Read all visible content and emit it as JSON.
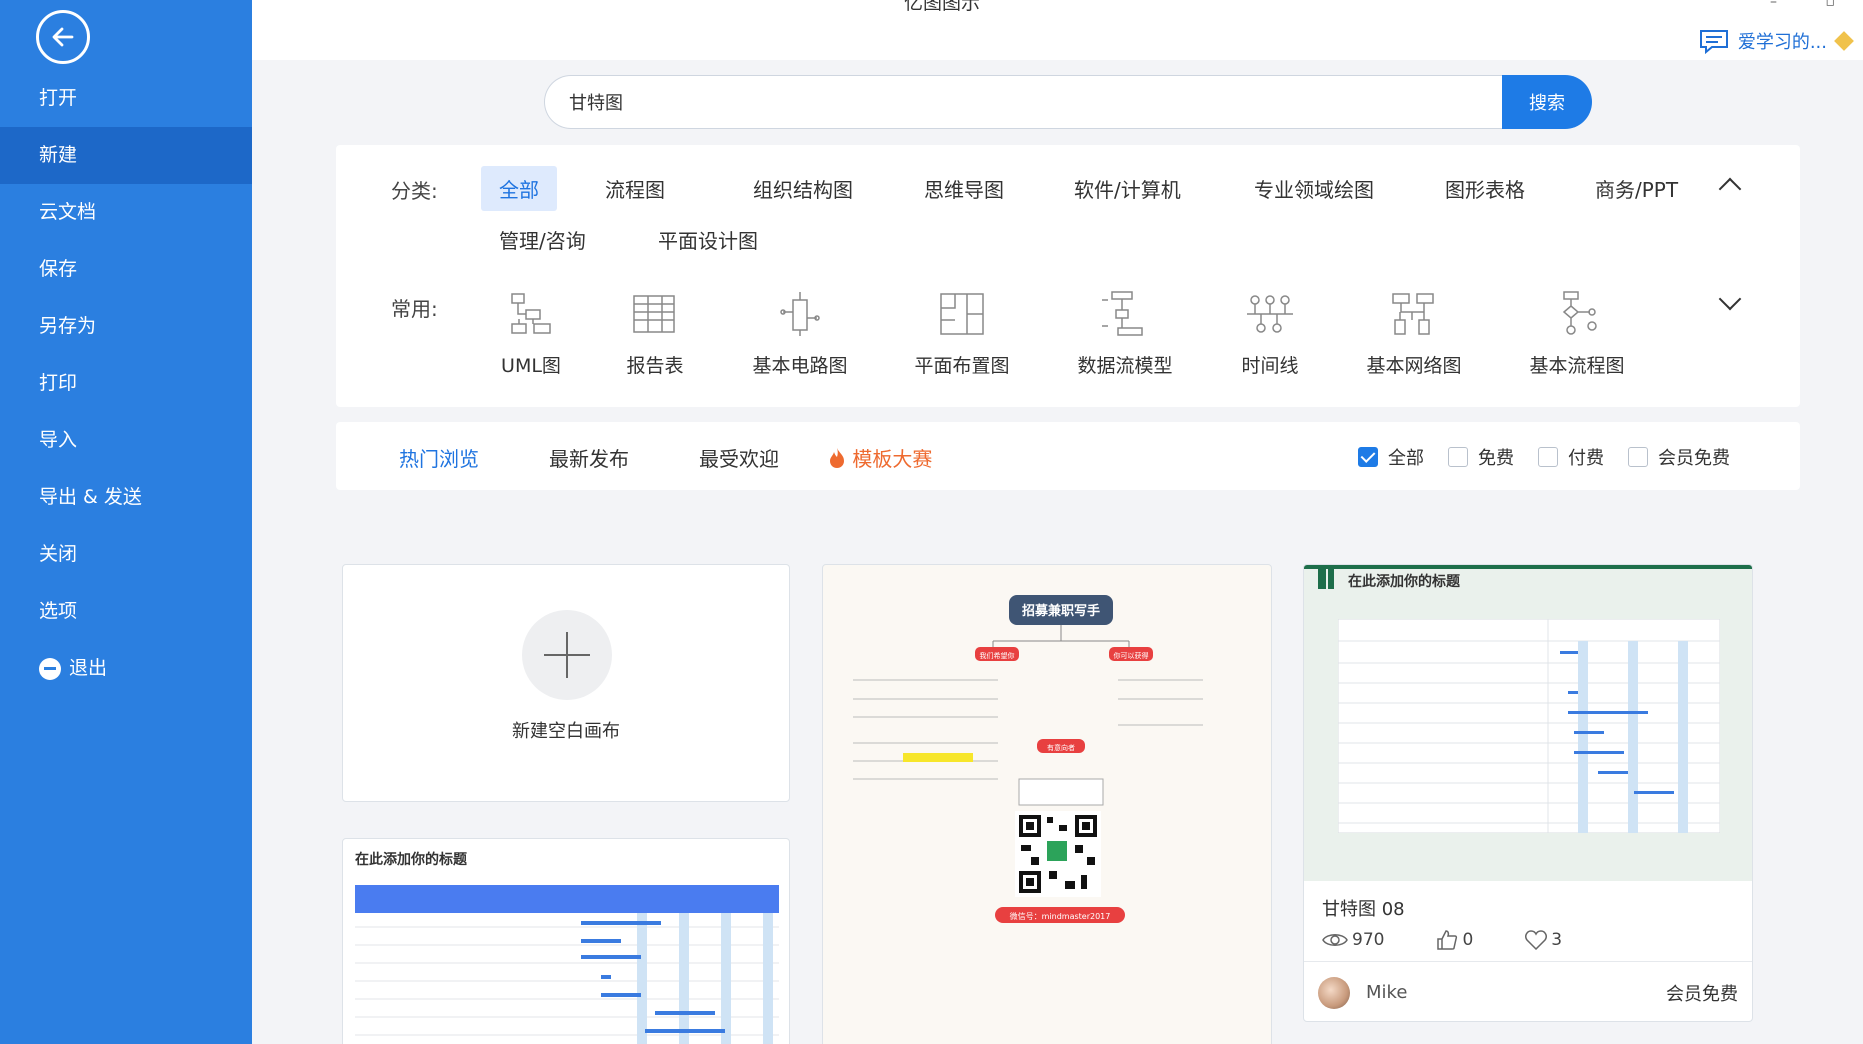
{
  "window": {
    "title": "亿图图示",
    "minimize": "–",
    "restore": "▫"
  },
  "user": {
    "name": "爱学习的..."
  },
  "sidebar": {
    "items": [
      {
        "label": "打开"
      },
      {
        "label": "新建"
      },
      {
        "label": "云文档"
      },
      {
        "label": "保存"
      },
      {
        "label": "另存为"
      },
      {
        "label": "打印"
      },
      {
        "label": "导入"
      },
      {
        "label": "导出 & 发送"
      },
      {
        "label": "关闭"
      },
      {
        "label": "选项"
      },
      {
        "label": "退出"
      }
    ],
    "active_index": 1
  },
  "search": {
    "value": "甘特图",
    "button": "搜索"
  },
  "categories": {
    "label": "分类:",
    "items": [
      "全部",
      "流程图",
      "组织结构图",
      "思维导图",
      "软件/计算机",
      "专业领域绘图",
      "图形表格",
      "商务/PPT",
      "管理/咨询",
      "平面设计图"
    ],
    "active": "全部"
  },
  "common": {
    "label": "常用:",
    "items": [
      "UML图",
      "报告表",
      "基本电路图",
      "平面布置图",
      "数据流模型",
      "时间线",
      "基本网络图",
      "基本流程图"
    ]
  },
  "tabs": {
    "items": [
      "热门浏览",
      "最新发布",
      "最受欢迎",
      "模板大赛"
    ],
    "active": "热门浏览"
  },
  "filters": [
    {
      "label": "全部",
      "checked": true
    },
    {
      "label": "免费",
      "checked": false
    },
    {
      "label": "付费",
      "checked": false
    },
    {
      "label": "会员免费",
      "checked": false
    }
  ],
  "cards": {
    "new_blank": {
      "label": "新建空白画布"
    },
    "gantt_preview_title": "在此添加你的标题",
    "recruit": {
      "title": "招募兼职写手",
      "left_tag": "我们希望你",
      "right_tag": "你可以获得",
      "bottom_tag": "有意向者",
      "wechat": "微信号：mindmaster2017"
    },
    "gantt08": {
      "preview_title": "在此添加你的标题",
      "name": "甘特图 08",
      "views": "970",
      "likes": "0",
      "favorites": "3",
      "author": "Mike",
      "price": "会员免费"
    }
  },
  "colors": {
    "sidebar": "#2b7fe0",
    "sidebar_active": "#1d68c8",
    "accent": "#1e7be6",
    "contest": "#ee6a2f"
  }
}
